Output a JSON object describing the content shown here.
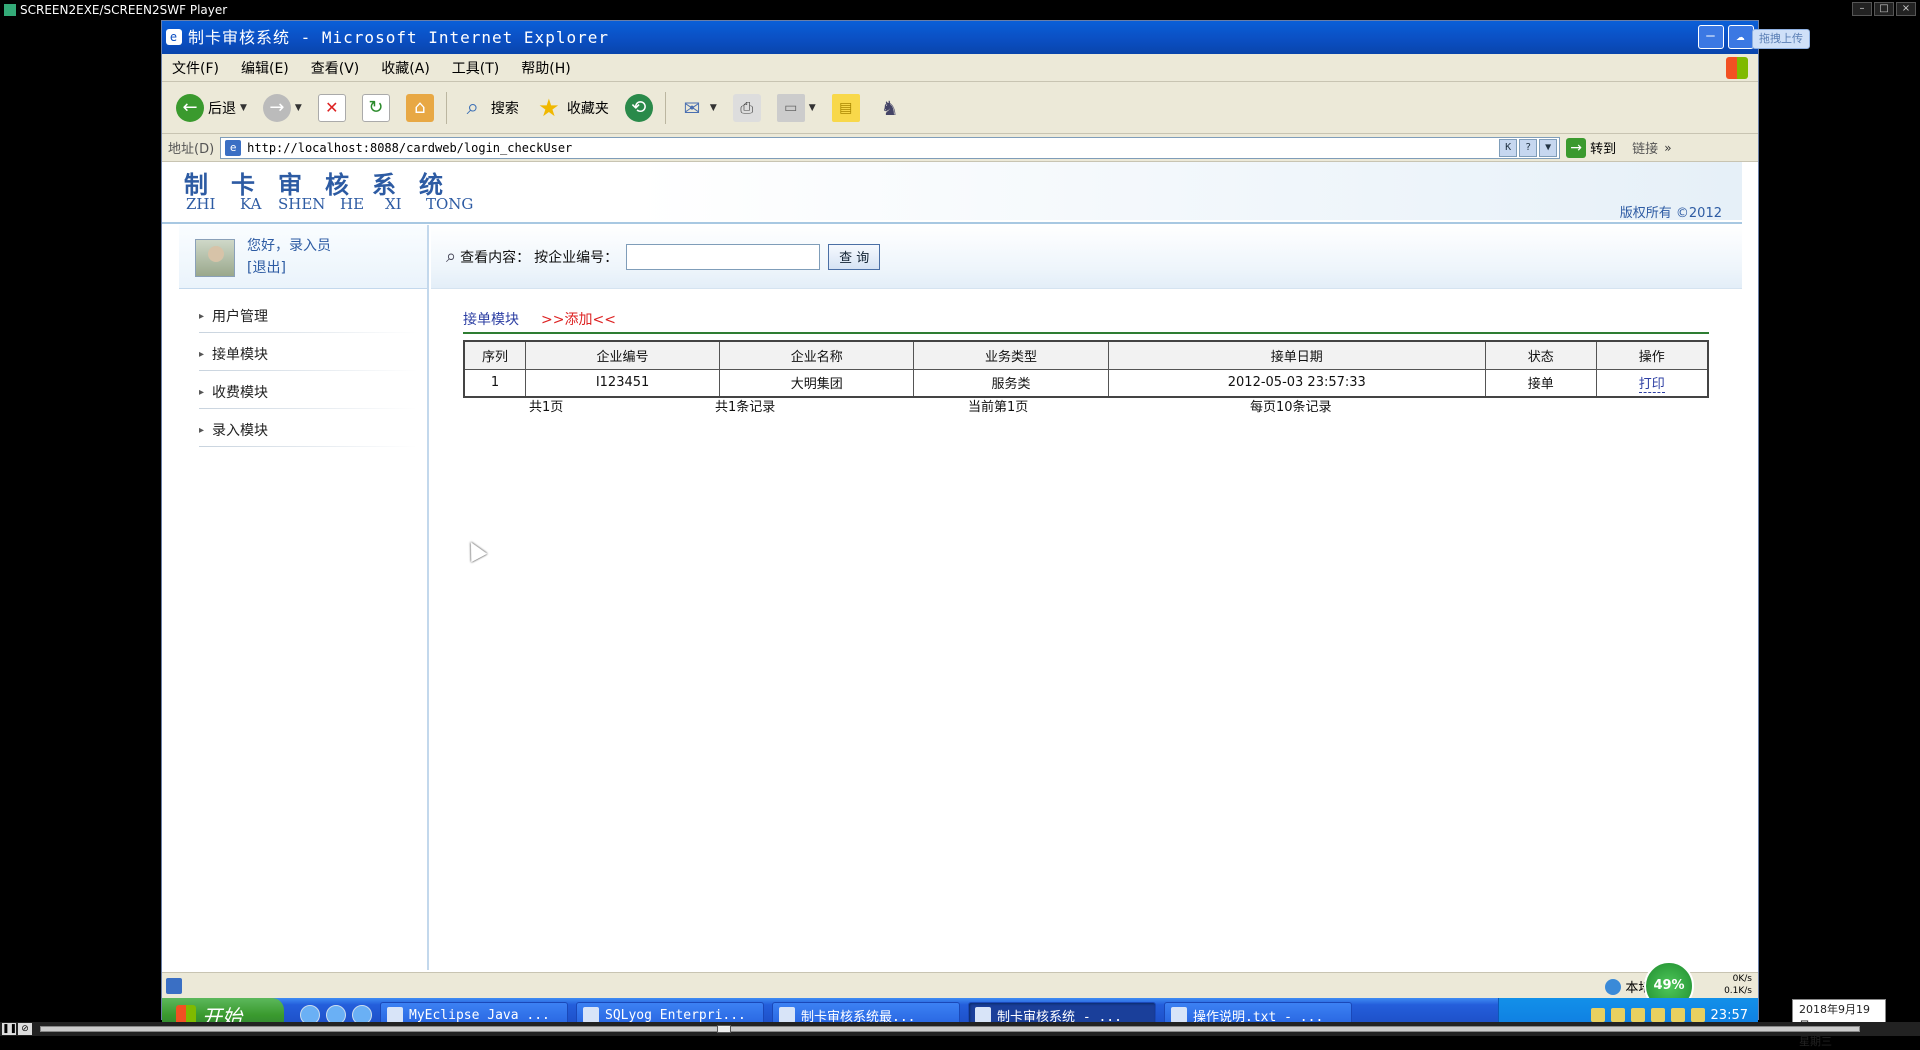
{
  "player": {
    "title": "SCREEN2EXE/SCREEN2SWF Player"
  },
  "ie": {
    "window_title": "制卡审核系统 - Microsoft Internet Explorer",
    "upload_badge": "拖拽上传",
    "menu": [
      "文件(F)",
      "编辑(E)",
      "查看(V)",
      "收藏(A)",
      "工具(T)",
      "帮助(H)"
    ],
    "toolbar": {
      "back_label": "后退",
      "search_label": "搜索",
      "favorites_label": "收藏夹"
    },
    "address": {
      "label": "地址(D)",
      "url": "http://localhost:8088/cardweb/login_checkUser",
      "go_label": "转到",
      "links_label": "链接"
    },
    "status": {
      "zone": "本地 Intr",
      "net_percent": "49%",
      "up_speed": "0K/s",
      "down_speed": "0.1K/s"
    }
  },
  "site": {
    "brand_cn": [
      "制",
      "卡",
      "审",
      "核",
      "系",
      "统"
    ],
    "brand_py": [
      "ZHI",
      "KA",
      "SHEN",
      "HE",
      "XI",
      "TONG"
    ],
    "copyright": "版权所有 ©2012",
    "user": {
      "greeting": "您好，录入员",
      "logout": "[退出]"
    },
    "nav": [
      "用户管理",
      "接单模块",
      "收费模块",
      "录入模块"
    ],
    "search": {
      "lookup_label": "查看内容：",
      "field_label": "按企业编号：",
      "input_value": "",
      "button_label": "查 询"
    },
    "module": {
      "name": "接单模块",
      "add_link": ">>添加<<"
    },
    "table": {
      "headers": [
        "序列",
        "企业编号",
        "企业名称",
        "业务类型",
        "接单日期",
        "状态",
        "操作"
      ],
      "rows": [
        [
          "1",
          "I123451",
          "大明集团",
          "服务类",
          "2012-05-03 23:57:33",
          "接单",
          "打印"
        ]
      ]
    },
    "pager": {
      "total_pages": "共1页",
      "total_records": "共1条记录",
      "current_page": "当前第1页",
      "per_page": "每页10条记录"
    }
  },
  "taskbar": {
    "start_label": "开始",
    "tasks": [
      "MyEclipse Java ...",
      "SQLyog Enterpri...",
      "制卡审核系统最...",
      "制卡审核系统 - ...",
      "操作说明.txt - ..."
    ],
    "active_task": 3,
    "clock": "23:57",
    "date_popup_line1": "2018年9月19日",
    "date_popup_line2": "星期三"
  }
}
